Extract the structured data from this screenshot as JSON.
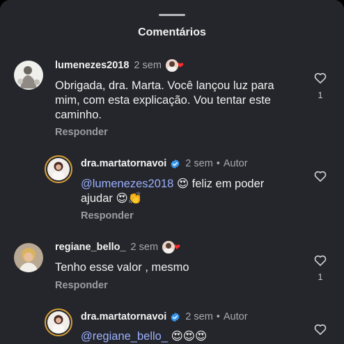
{
  "sheet": {
    "title": "Comentários"
  },
  "icons": {
    "drag": "drag-handle",
    "like": "heart-outline-icon",
    "verified": "verified-badge-icon"
  },
  "colors": {
    "background": "#25262b",
    "mention": "#9ab1ff",
    "verified": "#3797f0",
    "muted": "#a8a9ae"
  },
  "comments": [
    {
      "username": "lumenezes2018",
      "time": "2 sem",
      "text": "Obrigada, dra. Marta. Você lançou luz para mim, com esta explicação. Vou tentar este caminho.",
      "reply_label": "Responder",
      "likes": "1"
    },
    {
      "username": "dra.martatornavoi",
      "time": "2 sem",
      "author_label": "Autor",
      "mention": "@lumenezes2018",
      "text": "😍 feliz em poder ajudar 😍👏",
      "reply_label": "Responder"
    },
    {
      "username": "regiane_bello_",
      "time": "2 sem",
      "text": "Tenho esse valor , mesmo",
      "reply_label": "Responder",
      "likes": "1"
    },
    {
      "username": "dra.martatornavoi",
      "time": "2 sem",
      "author_label": "Autor",
      "mention": "@regiane_bello_",
      "text": "😍😍😍"
    }
  ]
}
